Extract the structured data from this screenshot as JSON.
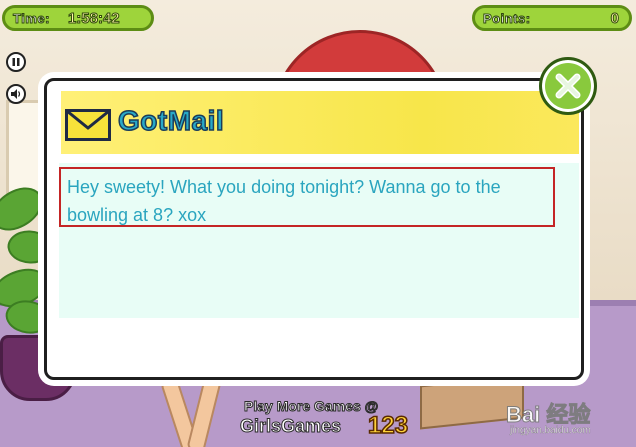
{
  "hud": {
    "time_label": "Time:",
    "time_value": "1:58:42",
    "points_label": "Points:",
    "points_value": "0"
  },
  "controls": {
    "pause_icon": "pause-icon",
    "sound_icon": "speaker-icon"
  },
  "dialog": {
    "title": "GotMail",
    "icon": "envelope-icon",
    "message": "Hey sweety! What you doing tonight? Wanna go to the bowling at 8? xox",
    "close_icon": "close-icon"
  },
  "branding": {
    "play_more": "Play More Games @",
    "site_name": "GirlsGames",
    "site_number": "123"
  },
  "watermark": {
    "main": "Bai 经验",
    "sub": "jingyan.baidu.com"
  },
  "colors": {
    "hud_green": "#9ed43b",
    "header_yellow": "#f7e64a",
    "message_text": "#2aa5bf",
    "highlight_border": "#c42525",
    "body_bg": "#e8fdf6"
  }
}
